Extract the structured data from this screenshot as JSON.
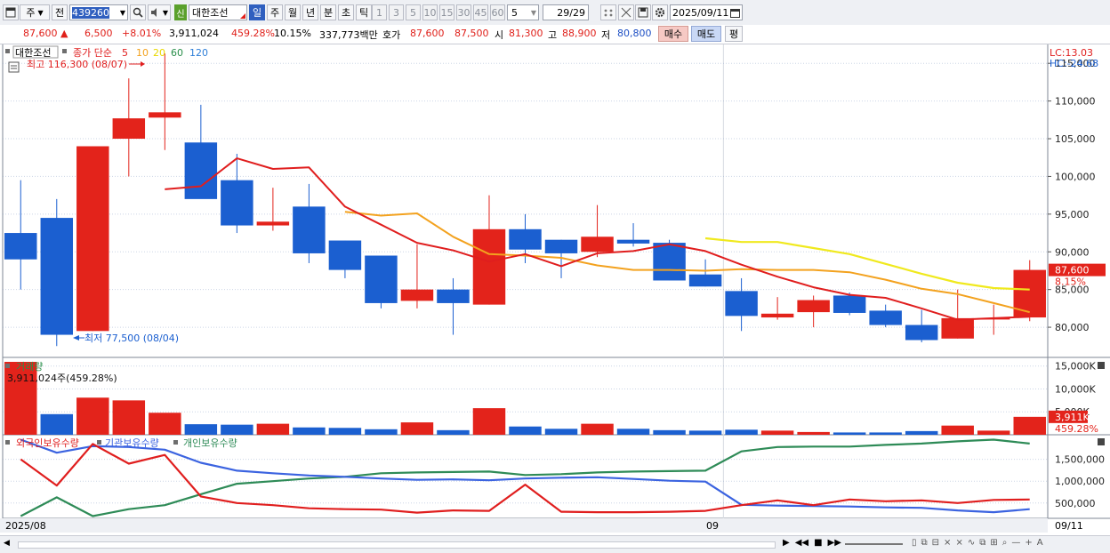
{
  "toolbar": {
    "mode": "주",
    "prev_label": "전",
    "code": "439260",
    "stock_name": "대한조선",
    "new_badge": "신",
    "periods": [
      "일",
      "주",
      "월",
      "년",
      "분",
      "초",
      "틱"
    ],
    "active_period": "일",
    "intervals": [
      "1",
      "3",
      "5",
      "10",
      "15",
      "30",
      "45",
      "60"
    ],
    "interval_value": "5",
    "count": "29/29",
    "date": "2025/09/11"
  },
  "infobar": {
    "price": "87,600",
    "arrow": "▲",
    "change": "6,500",
    "change_pct": "+8.01%",
    "volume": "3,911,024",
    "volume_pct": "459.28%",
    "turnover": "10.15%",
    "amount": "337,773백만",
    "quote_label": "호가",
    "ask": "87,600",
    "bid": "87,500",
    "open_label": "시",
    "open": "81,300",
    "high_label": "고",
    "high": "88,900",
    "low_label": "저",
    "low": "80,800",
    "buy_btn": "매수",
    "sell_btn": "매도",
    "eval_btn": "평"
  },
  "price_panel": {
    "name_tag": "대한조선",
    "ma_title": "종가 단순",
    "ma_periods": [
      "5",
      "10",
      "20",
      "60",
      "120"
    ],
    "high_note": "최고 116,300 (08/07)",
    "low_note": "최저 77,500 (08/04)",
    "lc": "LC:13.03",
    "hc": "HC:-24.68",
    "last_price": "87,600",
    "last_pct": "8.15%",
    "y_ticks": [
      "115,000",
      "110,000",
      "105,000",
      "100,000",
      "95,000",
      "90,000",
      "85,000",
      "80,000"
    ]
  },
  "volume_panel": {
    "title": "거래량",
    "note": "3,911,024주(459.28%)",
    "last_vol": "3,911K",
    "last_pct": "459.28%",
    "y_ticks": [
      "15,000K",
      "10,000K",
      "5,000K"
    ]
  },
  "holder_panel": {
    "legend": [
      "외국인보유수량",
      "기관보유수량",
      "개인보유수량"
    ],
    "y_ticks": [
      "1,500,000",
      "1,000,000",
      "500,000"
    ]
  },
  "x_labels": {
    "start": "2025/08",
    "mid": "09",
    "end": "09/11"
  },
  "colors": {
    "up": "#e3231b",
    "down": "#1b5fd0",
    "ma5": "#e01e1e",
    "ma10": "#f3a21f",
    "ma20": "#f0e91e",
    "ma60": "#2a8f4b",
    "ma120": "#2f7fd8",
    "foreign": "#e01e1e",
    "institution": "#3b63e0",
    "individual": "#2e8b57",
    "hline": "#8da3c8"
  },
  "chart_data": {
    "type": "candlestick",
    "ohlc": [
      [
        92500,
        99500,
        85000,
        89000
      ],
      [
        94500,
        97000,
        77500,
        79000
      ],
      [
        79500,
        104000,
        79500,
        104000
      ],
      [
        105000,
        113000,
        100000,
        107700
      ],
      [
        107800,
        116300,
        103500,
        108500
      ],
      [
        104500,
        109500,
        99000,
        97000
      ],
      [
        99500,
        103000,
        92500,
        93500
      ],
      [
        93500,
        98500,
        92800,
        94000
      ],
      [
        96000,
        99000,
        88500,
        89800
      ],
      [
        91500,
        91500,
        86500,
        87600
      ],
      [
        89500,
        89500,
        82500,
        83200
      ],
      [
        83500,
        91000,
        82500,
        85000
      ],
      [
        85000,
        86500,
        79000,
        83200
      ],
      [
        83000,
        97500,
        83000,
        93000
      ],
      [
        93000,
        95000,
        88500,
        90300
      ],
      [
        91600,
        91600,
        86500,
        89800
      ],
      [
        90000,
        96200,
        89300,
        92000
      ],
      [
        91600,
        93800,
        90700,
        91100
      ],
      [
        91200,
        91600,
        86200,
        86200
      ],
      [
        87000,
        89000,
        85400,
        85400
      ],
      [
        84800,
        86500,
        79500,
        81500
      ],
      [
        81300,
        84000,
        81000,
        81800
      ],
      [
        82000,
        84200,
        80000,
        83600
      ],
      [
        84200,
        84600,
        81600,
        81900
      ],
      [
        82200,
        83000,
        80000,
        80300
      ],
      [
        80300,
        82300,
        78000,
        78300
      ],
      [
        78500,
        85000,
        78500,
        81200
      ],
      [
        81200,
        83000,
        79000,
        81200
      ],
      [
        81300,
        88900,
        80800,
        87600
      ]
    ],
    "_ma": {
      "5": [
        null,
        null,
        null,
        null,
        98300,
        98700,
        102400,
        101000,
        101200,
        96000,
        93600,
        91200,
        90200,
        88700,
        89700,
        88100,
        89800,
        90100,
        91000,
        90100,
        88300,
        86700,
        85300,
        84300,
        83900,
        82500,
        81000,
        81200,
        81400
      ],
      "10": [
        null,
        null,
        null,
        null,
        null,
        null,
        null,
        null,
        null,
        95300,
        94800,
        95100,
        92000,
        89700,
        89500,
        89200,
        88200,
        87600,
        87600,
        87500,
        87700,
        87600,
        87600,
        87300,
        86300,
        85100,
        84400,
        83200,
        82000
      ],
      "20": [
        null,
        null,
        null,
        null,
        null,
        null,
        null,
        null,
        null,
        null,
        null,
        null,
        null,
        null,
        null,
        null,
        null,
        null,
        null,
        91800,
        91300,
        91300,
        90500,
        89700,
        88400,
        87100,
        85900,
        85200,
        85000
      ]
    },
    "ylim": [
      76000,
      117500
    ],
    "volume": [
      null,
      4500,
      8100,
      7500,
      4800,
      2300,
      2200,
      2400,
      1600,
      1500,
      1200,
      2700,
      1000,
      5800,
      1800,
      1300,
      2400,
      1300,
      1000,
      900,
      1100,
      900,
      600,
      500,
      500,
      800,
      2000,
      900,
      3911
    ],
    "_volume_max": 16300,
    "_holders": {
      "foreign": [
        1500000,
        900000,
        1850000,
        1400000,
        1600000,
        650000,
        500000,
        450000,
        380000,
        360000,
        350000,
        280000,
        330000,
        320000,
        920000,
        300000,
        290000,
        290000,
        300000,
        320000,
        450000,
        560000,
        450000,
        580000,
        540000,
        560000,
        500000,
        570000,
        580000
      ],
      "institution": [
        1950000,
        1650000,
        1800000,
        1780000,
        1720000,
        1420000,
        1240000,
        1180000,
        1130000,
        1100000,
        1060000,
        1030000,
        1040000,
        1020000,
        1060000,
        1080000,
        1090000,
        1050000,
        1010000,
        990000,
        460000,
        440000,
        430000,
        420000,
        400000,
        390000,
        330000,
        290000,
        360000
      ],
      "individual": [
        200000,
        630000,
        200000,
        360000,
        450000,
        700000,
        940000,
        1000000,
        1060000,
        1100000,
        1180000,
        1200000,
        1210000,
        1220000,
        1140000,
        1160000,
        1200000,
        1220000,
        1230000,
        1240000,
        1680000,
        1780000,
        1790000,
        1790000,
        1830000,
        1860000,
        1910000,
        1950000,
        1860000
      ]
    },
    "holders_ylim": [
      150000,
      2000000
    ]
  }
}
